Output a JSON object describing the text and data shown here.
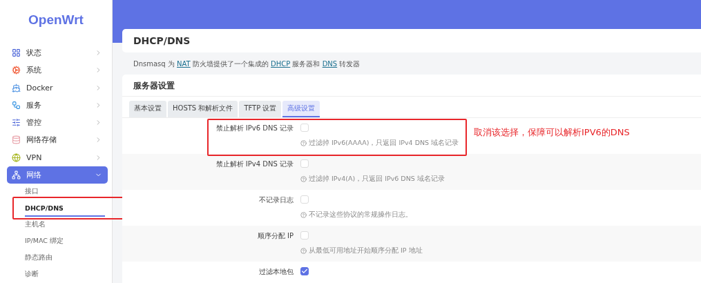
{
  "logo": "OpenWrt",
  "sidebar": {
    "items": [
      {
        "label": "状态",
        "expanded": false
      },
      {
        "label": "系统",
        "expanded": false
      },
      {
        "label": "Docker",
        "expanded": false
      },
      {
        "label": "服务",
        "expanded": false
      },
      {
        "label": "管控",
        "expanded": false
      },
      {
        "label": "网络存储",
        "expanded": false
      },
      {
        "label": "VPN",
        "expanded": false
      },
      {
        "label": "网络",
        "expanded": true,
        "children": [
          {
            "label": "接口",
            "selected": false
          },
          {
            "label": "DHCP/DNS",
            "selected": true
          },
          {
            "label": "主机名",
            "selected": false
          },
          {
            "label": "IP/MAC 绑定",
            "selected": false
          },
          {
            "label": "静态路由",
            "selected": false
          },
          {
            "label": "诊断",
            "selected": false
          }
        ]
      }
    ]
  },
  "page_title": "DHCP/DNS",
  "description": [
    {
      "text": "Dnsmasq 为 ",
      "link": false
    },
    {
      "text": "NAT",
      "link": true
    },
    {
      "text": " 防火墙提供了一个集成的 ",
      "link": false
    },
    {
      "text": "DHCP",
      "link": true
    },
    {
      "text": " 服务器和 ",
      "link": false
    },
    {
      "text": "DNS",
      "link": true
    },
    {
      "text": " 转发器",
      "link": false
    }
  ],
  "section_title": "服务器设置",
  "tabs": [
    {
      "label": "基本设置",
      "selected": false
    },
    {
      "label": "HOSTS 和解析文件",
      "selected": false
    },
    {
      "label": "TFTP 设置",
      "selected": false
    },
    {
      "label": "高级设置",
      "selected": true
    }
  ],
  "options": [
    {
      "label": "禁止解析 IPv6 DNS 记录",
      "checked": false,
      "help": "过滤掉 IPv6(AAAA)，只返回 IPv4 DNS 域名记录"
    },
    {
      "label": "禁止解析 IPv4 DNS 记录",
      "checked": false,
      "help": "过滤掉 IPv4(A)，只返回 IPv6 DNS 域名记录"
    },
    {
      "label": "不记录日志",
      "checked": false,
      "help": "不记录这些协议的常规操作日志。"
    },
    {
      "label": "顺序分配 IP",
      "checked": false,
      "help": "从最低可用地址开始顺序分配 IP 地址"
    },
    {
      "label": "过滤本地包",
      "checked": true
    }
  ],
  "annotation": "取消该选择，保障可以解析IPV6的DNS"
}
